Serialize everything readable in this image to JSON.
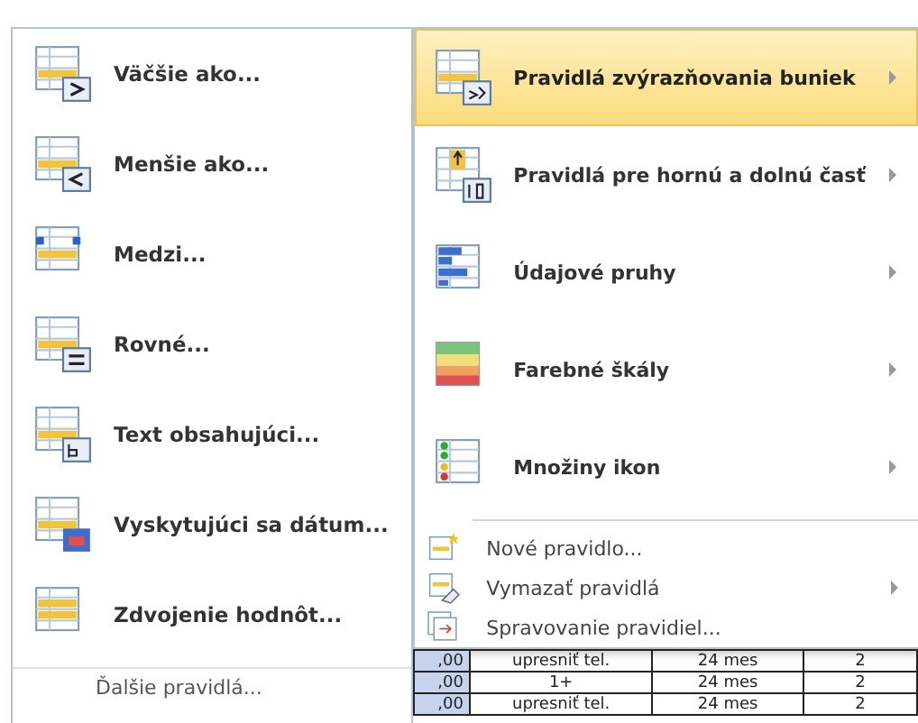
{
  "left_menu": {
    "items": [
      {
        "label": "Väčšie ako...",
        "kind": "greater"
      },
      {
        "label": "Menšie ako...",
        "kind": "less"
      },
      {
        "label": "Medzi...",
        "kind": "between"
      },
      {
        "label": "Rovné...",
        "kind": "equal"
      },
      {
        "label": "Text obsahujúci...",
        "kind": "text"
      },
      {
        "label": "Vyskytujúci sa dátum...",
        "kind": "date"
      },
      {
        "label": "Zdvojenie hodnôt...",
        "kind": "duplicate"
      }
    ],
    "footer": "Ďalšie pravidlá..."
  },
  "right_menu": {
    "items": [
      {
        "label": "Pravidlá zvýrazňovania buniek",
        "kind": "highlight",
        "selected": true,
        "submenu": true
      },
      {
        "label": "Pravidlá pre hornú a dolnú časť",
        "kind": "topbottom",
        "selected": false,
        "submenu": true
      },
      {
        "label": "Údajové pruhy",
        "kind": "databars",
        "selected": false,
        "submenu": true
      },
      {
        "label": "Farebné škály",
        "kind": "colorscales",
        "selected": false,
        "submenu": true
      },
      {
        "label": "Množiny ikon",
        "kind": "iconsets",
        "selected": false,
        "submenu": true
      }
    ],
    "commands": [
      {
        "label": "Nové pravidlo...",
        "kind": "new",
        "submenu": false
      },
      {
        "label": "Vymazať pravidlá",
        "kind": "clear",
        "submenu": true
      },
      {
        "label": "Spravovanie pravidiel...",
        "kind": "manage",
        "submenu": false
      }
    ]
  },
  "sheet": {
    "rows": [
      {
        "cells": [
          ",00",
          "upresniť tel.",
          "24 mes",
          "2"
        ]
      },
      {
        "cells": [
          ",00",
          "1+",
          "24 mes",
          "2"
        ]
      },
      {
        "cells": [
          ",00",
          "upresniť tel.",
          "24 mes",
          "2"
        ]
      }
    ]
  }
}
